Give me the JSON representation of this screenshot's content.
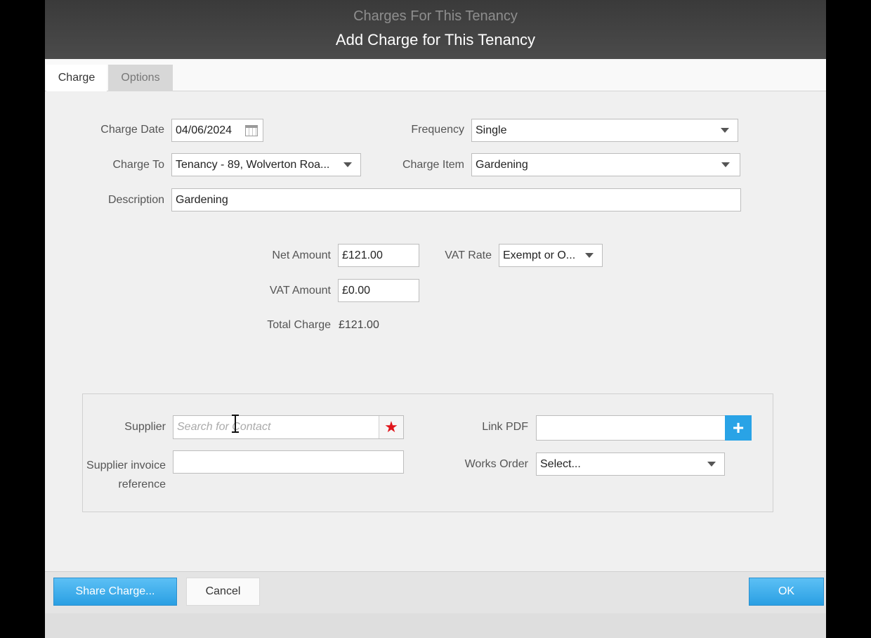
{
  "window": {
    "background_title": "Charges For This Tenancy",
    "dialog_title": "Add Charge for This Tenancy"
  },
  "tabs": [
    {
      "label": "Charge",
      "active": true
    },
    {
      "label": "Options",
      "active": false
    }
  ],
  "form": {
    "charge_date": {
      "label": "Charge Date",
      "value": "04/06/2024",
      "icon": "calendar-icon"
    },
    "frequency": {
      "label": "Frequency",
      "value": "Single"
    },
    "charge_to": {
      "label": "Charge To",
      "value": "Tenancy - 89, Wolverton Roa..."
    },
    "charge_item": {
      "label": "Charge Item",
      "value": "Gardening"
    },
    "description": {
      "label": "Description",
      "value": "Gardening"
    }
  },
  "amounts": {
    "net_amount": {
      "label": "Net Amount",
      "value": "£121.00"
    },
    "vat_rate": {
      "label": "VAT Rate",
      "value": "Exempt or O..."
    },
    "vat_amount": {
      "label": "VAT Amount",
      "value": "£0.00"
    },
    "total_charge": {
      "label": "Total Charge",
      "value": "£121.00"
    }
  },
  "supplier_section": {
    "supplier": {
      "label": "Supplier",
      "placeholder": "Search for Contact",
      "icon": "star-icon"
    },
    "supplier_invoice_reference": {
      "label_line1": "Supplier invoice",
      "label_line2": "reference",
      "value": ""
    },
    "link_pdf": {
      "label": "Link PDF",
      "value": "",
      "icon": "plus-icon"
    },
    "works_order": {
      "label": "Works Order",
      "value": "Select..."
    }
  },
  "footer": {
    "share_label": "Share Charge...",
    "cancel_label": "Cancel",
    "ok_label": "OK"
  },
  "colors": {
    "accent_blue": "#2a9fe3",
    "star_red": "#e0151b",
    "header_dark": "#444444"
  }
}
